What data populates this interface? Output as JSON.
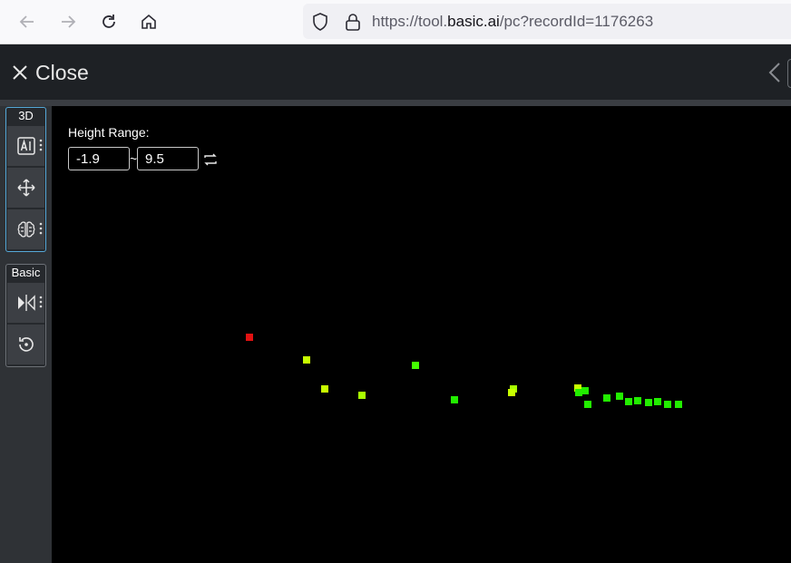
{
  "browser": {
    "url_prefix": "https://tool.",
    "url_host": "basic.ai",
    "url_path": "/pc?recordId=1176263"
  },
  "app": {
    "close_label": "Close"
  },
  "sidebar": {
    "group_3d_label": "3D",
    "group_basic_label": "Basic",
    "tools_3d": [
      "ai-annotate-icon",
      "move-icon",
      "brain-icon"
    ],
    "tools_basic": [
      "flip-compare-icon",
      "reset-rotate-icon"
    ]
  },
  "filter": {
    "label": "Height Range:",
    "min": "-1.9",
    "separator": "~",
    "max": "9.5"
  },
  "colors": {
    "point_red": "#e11111",
    "point_yellow": "#c8ff00",
    "point_green": "#22ee00",
    "accent_blue": "#55a8d8"
  }
}
